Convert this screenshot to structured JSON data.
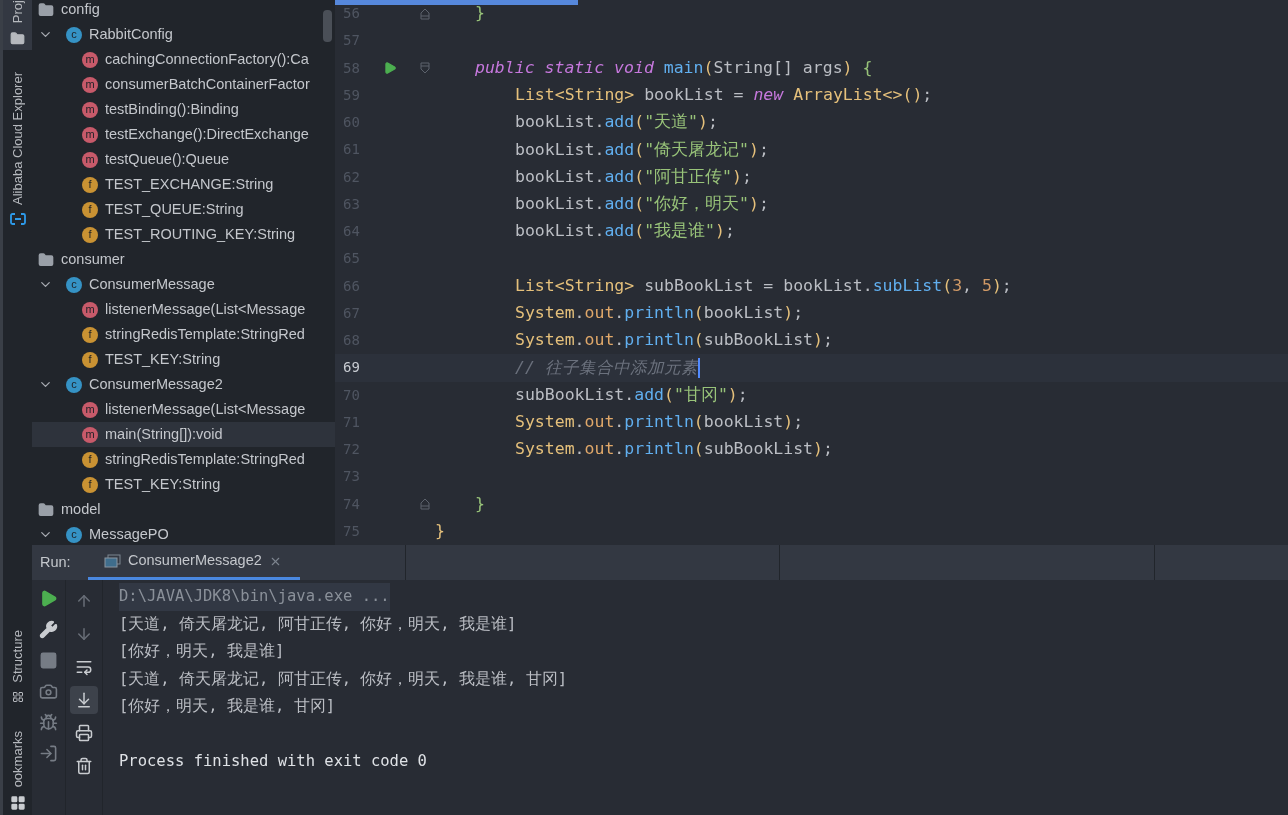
{
  "tool_strip": {
    "top": [
      {
        "label": "Proj",
        "selected": true
      },
      {
        "label": "Alibaba Cloud Explorer",
        "selected": false
      }
    ],
    "bottom": [
      {
        "label": "Structure",
        "selected": false
      },
      {
        "label": "ookmarks",
        "selected": false
      }
    ]
  },
  "project_tree": [
    {
      "kind": "package",
      "label": "config",
      "selected": false
    },
    {
      "kind": "class",
      "badge": "c",
      "label": "RabbitConfig",
      "expanded": true,
      "selected": false,
      "children": [
        {
          "kind": "method",
          "badge": "m",
          "label": "cachingConnectionFactory():Ca",
          "selected": false
        },
        {
          "kind": "method",
          "badge": "m",
          "label": "consumerBatchContainerFactor",
          "selected": false
        },
        {
          "kind": "method",
          "badge": "m",
          "label": "testBinding():Binding",
          "selected": false
        },
        {
          "kind": "method",
          "badge": "m",
          "label": "testExchange():DirectExchange",
          "selected": false
        },
        {
          "kind": "method",
          "badge": "m",
          "label": "testQueue():Queue",
          "selected": false
        },
        {
          "kind": "field",
          "badge": "f",
          "label": "TEST_EXCHANGE:String",
          "selected": false
        },
        {
          "kind": "field",
          "badge": "f",
          "label": "TEST_QUEUE:String",
          "selected": false
        },
        {
          "kind": "field",
          "badge": "f",
          "label": "TEST_ROUTING_KEY:String",
          "selected": false
        }
      ]
    },
    {
      "kind": "package",
      "label": "consumer",
      "selected": false
    },
    {
      "kind": "class",
      "badge": "c",
      "label": "ConsumerMessage",
      "expanded": true,
      "selected": false,
      "children": [
        {
          "kind": "method",
          "badge": "m",
          "label": "listenerMessage(List<Message",
          "selected": false
        },
        {
          "kind": "field",
          "badge": "f",
          "label": "stringRedisTemplate:StringRed",
          "selected": false
        },
        {
          "kind": "field",
          "badge": "f",
          "label": "TEST_KEY:String",
          "selected": false
        }
      ]
    },
    {
      "kind": "class",
      "badge": "c",
      "label": "ConsumerMessage2",
      "expanded": true,
      "selected": false,
      "children": [
        {
          "kind": "method",
          "badge": "m",
          "label": "listenerMessage(List<Message",
          "selected": false
        },
        {
          "kind": "method",
          "badge": "m",
          "label": "main(String[]):void",
          "selected": true
        },
        {
          "kind": "field",
          "badge": "f",
          "label": "stringRedisTemplate:StringRed",
          "selected": false
        },
        {
          "kind": "field",
          "badge": "f",
          "label": "TEST_KEY:String",
          "selected": false
        }
      ]
    },
    {
      "kind": "package",
      "label": "model",
      "selected": false
    },
    {
      "kind": "class",
      "badge": "c",
      "label": "MessagePO",
      "expanded": true,
      "selected": false
    }
  ],
  "editor": {
    "lines": [
      {
        "number": "56",
        "kind": "member",
        "current": false,
        "run": false,
        "fold_open": false,
        "fold_close": true,
        "tokens": [
          {
            "text": "}",
            "kind": "brace"
          }
        ]
      },
      {
        "number": "57",
        "kind": "blank",
        "current": false,
        "run": false,
        "fold_open": false,
        "fold_close": false
      },
      {
        "number": "58",
        "kind": "member",
        "current": false,
        "run": true,
        "fold_open": true,
        "fold_close": false,
        "tokens": [
          {
            "text": "public static void ",
            "kind": "keyword"
          },
          {
            "text": "main",
            "kind": "method"
          },
          {
            "text": "(",
            "kind": "paren"
          },
          {
            "text": "String[] args",
            "kind": "plain"
          },
          {
            "text": ")",
            "kind": "paren"
          },
          {
            "text": " {",
            "kind": "brace"
          }
        ]
      },
      {
        "number": "59",
        "kind": "body",
        "current": false,
        "run": false,
        "fold_open": false,
        "fold_close": false,
        "tokens": [
          {
            "text": "List<String>",
            "kind": "type"
          },
          {
            "text": " bookList = ",
            "kind": "plain"
          },
          {
            "text": "new ",
            "kind": "keyword"
          },
          {
            "text": "ArrayList<>()",
            "kind": "type"
          },
          {
            "text": ";",
            "kind": "plain"
          }
        ]
      },
      {
        "number": "60",
        "kind": "body",
        "current": false,
        "run": false,
        "fold_open": false,
        "fold_close": false,
        "tokens": [
          {
            "text": "bookList.",
            "kind": "plain"
          },
          {
            "text": "add",
            "kind": "method"
          },
          {
            "text": "(",
            "kind": "paren"
          },
          {
            "text": "\"天道\"",
            "kind": "string"
          },
          {
            "text": ")",
            "kind": "paren"
          },
          {
            "text": ";",
            "kind": "plain"
          }
        ]
      },
      {
        "number": "61",
        "kind": "body",
        "current": false,
        "run": false,
        "fold_open": false,
        "fold_close": false,
        "tokens": [
          {
            "text": "bookList.",
            "kind": "plain"
          },
          {
            "text": "add",
            "kind": "method"
          },
          {
            "text": "(",
            "kind": "paren"
          },
          {
            "text": "\"倚天屠龙记\"",
            "kind": "string"
          },
          {
            "text": ")",
            "kind": "paren"
          },
          {
            "text": ";",
            "kind": "plain"
          }
        ]
      },
      {
        "number": "62",
        "kind": "body",
        "current": false,
        "run": false,
        "fold_open": false,
        "fold_close": false,
        "tokens": [
          {
            "text": "bookList.",
            "kind": "plain"
          },
          {
            "text": "add",
            "kind": "method"
          },
          {
            "text": "(",
            "kind": "paren"
          },
          {
            "text": "\"阿甘正传\"",
            "kind": "string"
          },
          {
            "text": ")",
            "kind": "paren"
          },
          {
            "text": ";",
            "kind": "plain"
          }
        ]
      },
      {
        "number": "63",
        "kind": "body",
        "current": false,
        "run": false,
        "fold_open": false,
        "fold_close": false,
        "tokens": [
          {
            "text": "bookList.",
            "kind": "plain"
          },
          {
            "text": "add",
            "kind": "method"
          },
          {
            "text": "(",
            "kind": "paren"
          },
          {
            "text": "\"你好，明天\"",
            "kind": "string"
          },
          {
            "text": ")",
            "kind": "paren"
          },
          {
            "text": ";",
            "kind": "plain"
          }
        ]
      },
      {
        "number": "64",
        "kind": "body",
        "current": false,
        "run": false,
        "fold_open": false,
        "fold_close": false,
        "tokens": [
          {
            "text": "bookList.",
            "kind": "plain"
          },
          {
            "text": "add",
            "kind": "method"
          },
          {
            "text": "(",
            "kind": "paren"
          },
          {
            "text": "\"我是谁\"",
            "kind": "string"
          },
          {
            "text": ")",
            "kind": "paren"
          },
          {
            "text": ";",
            "kind": "plain"
          }
        ]
      },
      {
        "number": "65",
        "kind": "blank",
        "current": false,
        "run": false,
        "fold_open": false,
        "fold_close": false
      },
      {
        "number": "66",
        "kind": "body",
        "current": false,
        "run": false,
        "fold_open": false,
        "fold_close": false,
        "tokens": [
          {
            "text": "List<String>",
            "kind": "type"
          },
          {
            "text": " subBookList = bookList.",
            "kind": "plain"
          },
          {
            "text": "subList",
            "kind": "method"
          },
          {
            "text": "(",
            "kind": "paren"
          },
          {
            "text": "3",
            "kind": "number"
          },
          {
            "text": ", ",
            "kind": "plain"
          },
          {
            "text": "5",
            "kind": "number"
          },
          {
            "text": ")",
            "kind": "paren"
          },
          {
            "text": ";",
            "kind": "plain"
          }
        ]
      },
      {
        "number": "67",
        "kind": "body",
        "current": false,
        "run": false,
        "fold_open": false,
        "fold_close": false,
        "tokens": [
          {
            "text": "System",
            "kind": "type"
          },
          {
            "text": ".",
            "kind": "plain"
          },
          {
            "text": "out",
            "kind": "field"
          },
          {
            "text": ".",
            "kind": "plain"
          },
          {
            "text": "println",
            "kind": "method"
          },
          {
            "text": "(",
            "kind": "paren"
          },
          {
            "text": "bookList",
            "kind": "plain"
          },
          {
            "text": ")",
            "kind": "paren"
          },
          {
            "text": ";",
            "kind": "plain"
          }
        ]
      },
      {
        "number": "68",
        "kind": "body",
        "current": false,
        "run": false,
        "fold_open": false,
        "fold_close": false,
        "tokens": [
          {
            "text": "System",
            "kind": "type"
          },
          {
            "text": ".",
            "kind": "plain"
          },
          {
            "text": "out",
            "kind": "field"
          },
          {
            "text": ".",
            "kind": "plain"
          },
          {
            "text": "println",
            "kind": "method"
          },
          {
            "text": "(",
            "kind": "paren"
          },
          {
            "text": "subBookList",
            "kind": "plain"
          },
          {
            "text": ")",
            "kind": "paren"
          },
          {
            "text": ";",
            "kind": "plain"
          }
        ]
      },
      {
        "number": "69",
        "kind": "body",
        "current": true,
        "run": false,
        "fold_open": false,
        "fold_close": false,
        "tokens": [
          {
            "text": "// 往子集合中添加元素",
            "kind": "comment"
          }
        ]
      },
      {
        "number": "70",
        "kind": "body",
        "current": false,
        "run": false,
        "fold_open": false,
        "fold_close": false,
        "tokens": [
          {
            "text": "subBookList.",
            "kind": "plain"
          },
          {
            "text": "add",
            "kind": "method"
          },
          {
            "text": "(",
            "kind": "paren"
          },
          {
            "text": "\"甘冈\"",
            "kind": "string"
          },
          {
            "text": ")",
            "kind": "paren"
          },
          {
            "text": ";",
            "kind": "plain"
          }
        ]
      },
      {
        "number": "71",
        "kind": "body",
        "current": false,
        "run": false,
        "fold_open": false,
        "fold_close": false,
        "tokens": [
          {
            "text": "System",
            "kind": "type"
          },
          {
            "text": ".",
            "kind": "plain"
          },
          {
            "text": "out",
            "kind": "field"
          },
          {
            "text": ".",
            "kind": "plain"
          },
          {
            "text": "println",
            "kind": "method"
          },
          {
            "text": "(",
            "kind": "paren"
          },
          {
            "text": "bookList",
            "kind": "plain"
          },
          {
            "text": ")",
            "kind": "paren"
          },
          {
            "text": ";",
            "kind": "plain"
          }
        ]
      },
      {
        "number": "72",
        "kind": "body",
        "current": false,
        "run": false,
        "fold_open": false,
        "fold_close": false,
        "tokens": [
          {
            "text": "System",
            "kind": "type"
          },
          {
            "text": ".",
            "kind": "plain"
          },
          {
            "text": "out",
            "kind": "field"
          },
          {
            "text": ".",
            "kind": "plain"
          },
          {
            "text": "println",
            "kind": "method"
          },
          {
            "text": "(",
            "kind": "paren"
          },
          {
            "text": "subBookList",
            "kind": "plain"
          },
          {
            "text": ")",
            "kind": "paren"
          },
          {
            "text": ";",
            "kind": "plain"
          }
        ]
      },
      {
        "number": "73",
        "kind": "blank",
        "current": false,
        "run": false,
        "fold_open": false,
        "fold_close": false
      },
      {
        "number": "74",
        "kind": "member",
        "current": false,
        "run": false,
        "fold_open": false,
        "fold_close": true,
        "tokens": [
          {
            "text": "}",
            "kind": "brace"
          }
        ]
      },
      {
        "number": "75",
        "kind": "class",
        "current": false,
        "run": false,
        "fold_open": false,
        "fold_close": false,
        "tokens": [
          {
            "text": "}",
            "kind": "paren"
          }
        ]
      }
    ]
  },
  "run_panel": {
    "label": "Run:",
    "tabs": [
      {
        "label": "ConsumerMessage2",
        "selected": true
      }
    ],
    "left_tools": [
      {
        "kind": "rerun"
      },
      {
        "kind": "settings"
      },
      {
        "kind": "stop"
      },
      {
        "kind": "camera"
      },
      {
        "kind": "debug"
      },
      {
        "kind": "restore"
      }
    ],
    "right_tools": [
      {
        "kind": "up",
        "selected": false
      },
      {
        "kind": "down",
        "selected": false
      },
      {
        "kind": "wrap",
        "selected": false
      },
      {
        "kind": "scroll-end",
        "selected": true
      },
      {
        "kind": "print",
        "selected": false
      },
      {
        "kind": "trash",
        "selected": false
      }
    ],
    "console": [
      {
        "kind": "command",
        "text": "D:\\JAVA\\JDK8\\bin\\java.exe ..."
      },
      {
        "kind": "output",
        "text": "[天道, 倚天屠龙记, 阿甘正传, 你好，明天, 我是谁]"
      },
      {
        "kind": "output",
        "text": "[你好，明天, 我是谁]"
      },
      {
        "kind": "output",
        "text": "[天道, 倚天屠龙记, 阿甘正传, 你好，明天, 我是谁, 甘冈]"
      },
      {
        "kind": "output",
        "text": "[你好，明天, 我是谁, 甘冈]"
      },
      {
        "kind": "status",
        "text": "Process finished with exit code 0"
      }
    ]
  }
}
